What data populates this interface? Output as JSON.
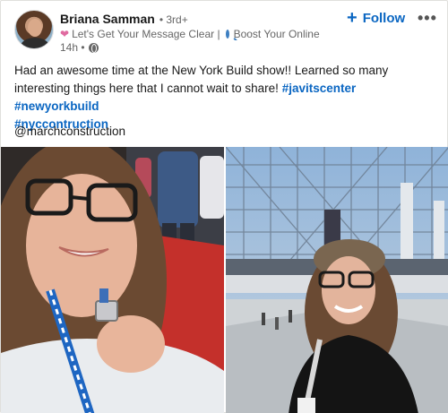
{
  "author": {
    "name": "Briana Samman",
    "degree": "• 3rd+",
    "headline": "Let's Get Your Message Clear | ",
    "headline_2": "Boost Your Online Vi...",
    "time": "14h •"
  },
  "actions": {
    "follow_label": "Follow"
  },
  "post": {
    "text": "Had an awesome time at the New York Build show!! Learned so many interesting things here that I cannot wait to share! ",
    "hashtags": [
      "#javitscenter",
      "#newyorkbuild",
      "#nyccontruction"
    ],
    "mention": "@marchconstruction"
  },
  "colors": {
    "link": "#0a66c2",
    "carpet": "#c4302b"
  },
  "icons": {
    "heart": "heart-icon",
    "search": "search-icon",
    "globe": "globe-icon",
    "more": "more-icon"
  }
}
